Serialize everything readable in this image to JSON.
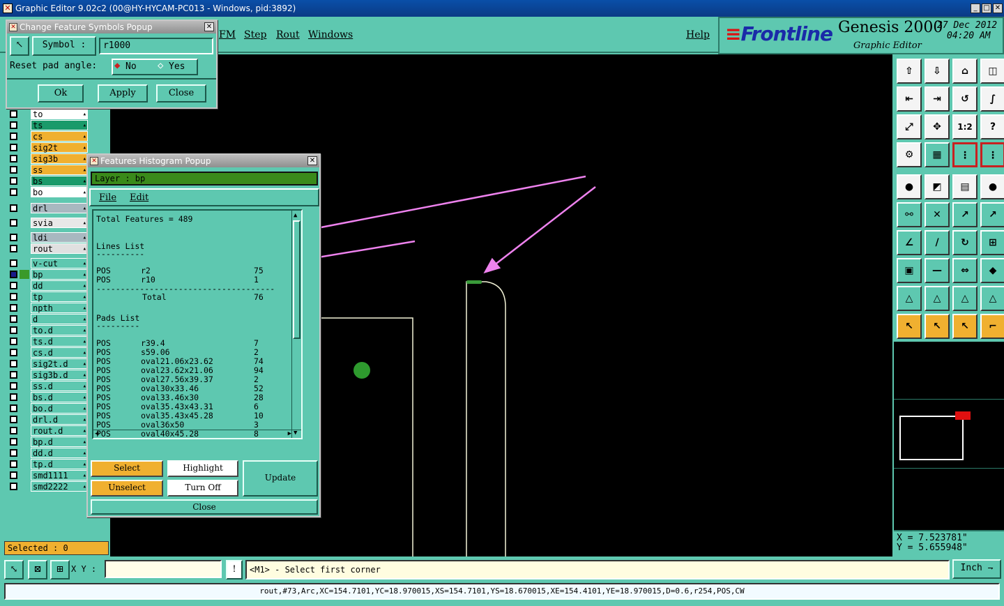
{
  "window": {
    "title": "Graphic Editor 9.02c2 (00@HY-HYCAM-PC013 - Windows, pid:3892)",
    "min": "_",
    "max": "□",
    "close": "✕"
  },
  "menus": {
    "fm": "FM",
    "step": "Step",
    "rout": "Rout",
    "windows": "Windows",
    "help": "Help"
  },
  "brand": {
    "frontline": "Frontline",
    "genesis": "Genesis 2000",
    "subtitle": "Graphic Editor",
    "date": "27 Dec 2012",
    "time": "04:20 AM"
  },
  "change_symbol_popup": {
    "title": "Change Feature Symbols Popup",
    "symbol_label": "Symbol :",
    "symbol_value": "r1000",
    "reset_label": "Reset pad angle:",
    "opt_no": "No",
    "opt_yes": "Yes",
    "ok": "Ok",
    "apply": "Apply",
    "close": "Close"
  },
  "layers": [
    {
      "name": "to",
      "color": "#ffffff"
    },
    {
      "name": "ts",
      "color": "#1a9a6a"
    },
    {
      "name": "cs",
      "color": "#f0b030"
    },
    {
      "name": "sig2t",
      "color": "#f0b030"
    },
    {
      "name": "sig3b",
      "color": "#f0b030"
    },
    {
      "name": "ss",
      "color": "#f0b030"
    },
    {
      "name": "bs",
      "color": "#1a9a6a"
    },
    {
      "name": "bo",
      "color": "#ffffff"
    },
    {
      "name": "drl",
      "color": "#a8b8c0"
    },
    {
      "name": "svia",
      "color": "#e8e8e8"
    },
    {
      "name": "ldi",
      "color": "#a8b8c0"
    },
    {
      "name": "rout",
      "color": "#e0e0e0"
    },
    {
      "name": "v-cut",
      "color": "#5ec8b0"
    },
    {
      "name": "bp",
      "color": "#5ec8b0"
    },
    {
      "name": "dd",
      "color": "#5ec8b0"
    },
    {
      "name": "tp",
      "color": "#5ec8b0"
    },
    {
      "name": "npth",
      "color": "#5ec8b0"
    },
    {
      "name": "d",
      "color": "#5ec8b0"
    },
    {
      "name": "to.d",
      "color": "#5ec8b0"
    },
    {
      "name": "ts.d",
      "color": "#5ec8b0"
    },
    {
      "name": "cs.d",
      "color": "#5ec8b0"
    },
    {
      "name": "sig2t.d",
      "color": "#5ec8b0"
    },
    {
      "name": "sig3b.d",
      "color": "#5ec8b0"
    },
    {
      "name": "ss.d",
      "color": "#5ec8b0"
    },
    {
      "name": "bs.d",
      "color": "#5ec8b0"
    },
    {
      "name": "bo.d",
      "color": "#5ec8b0"
    },
    {
      "name": "drl.d",
      "color": "#5ec8b0"
    },
    {
      "name": "rout.d",
      "color": "#5ec8b0"
    },
    {
      "name": "bp.d",
      "color": "#5ec8b0"
    },
    {
      "name": "dd.d",
      "color": "#5ec8b0"
    },
    {
      "name": "tp.d",
      "color": "#5ec8b0"
    },
    {
      "name": "smd1111",
      "color": "#5ec8b0"
    },
    {
      "name": "smd2222",
      "color": "#5ec8b0"
    }
  ],
  "selected": "Selected : 0",
  "histogram": {
    "title": "Features Histogram Popup",
    "layer": "Layer :  bp",
    "menu_file": "File",
    "menu_edit": "Edit",
    "total_features": "Total Features = 489",
    "lines_title": "Lines List",
    "lines": [
      {
        "pol": "POS",
        "sym": "r2",
        "count": "75"
      },
      {
        "pol": "POS",
        "sym": "r10",
        "count": "1"
      }
    ],
    "lines_total_label": "Total",
    "lines_total": "76",
    "pads_title": "Pads List",
    "pads": [
      {
        "pol": "POS",
        "sym": "r39.4",
        "count": "7"
      },
      {
        "pol": "POS",
        "sym": "s59.06",
        "count": "2"
      },
      {
        "pol": "POS",
        "sym": "oval21.06x23.62",
        "count": "74"
      },
      {
        "pol": "POS",
        "sym": "oval23.62x21.06",
        "count": "94"
      },
      {
        "pol": "POS",
        "sym": "oval27.56x39.37",
        "count": "2"
      },
      {
        "pol": "POS",
        "sym": "oval30x33.46",
        "count": "52"
      },
      {
        "pol": "POS",
        "sym": "oval33.46x30",
        "count": "28"
      },
      {
        "pol": "POS",
        "sym": "oval35.43x43.31",
        "count": "6"
      },
      {
        "pol": "POS",
        "sym": "oval35.43x45.28",
        "count": "10"
      },
      {
        "pol": "POS",
        "sym": "oval36x50",
        "count": "3"
      },
      {
        "pol": "POS",
        "sym": "oval40x45.28",
        "count": "8"
      }
    ],
    "select": "Select",
    "highlight": "Highlight",
    "update": "Update",
    "unselect": "Unselect",
    "turn_off": "Turn Off",
    "close": "Close"
  },
  "coords": {
    "x": "X = 7.523781\"",
    "y": "Y = 5.655948\""
  },
  "bottom": {
    "xy_label": "X Y :",
    "xy_value": "",
    "prompt": "<M1> - Select first corner",
    "units": "Inch"
  },
  "status": "rout,#73,Arc,XC=154.7101,YC=18.970015,XS=154.7101,YS=18.670015,XE=154.4101,YE=18.970015,D=0.6,r254,POS,CW",
  "colors": {
    "bg": "#5ec8b0",
    "annotation": "#ee82ee",
    "pad_green": "#2e9a2e",
    "highlight_orange": "#f0b030"
  },
  "icons": [
    "layer-up-icon",
    "layer-down-icon",
    "home-icon",
    "split-icon",
    "pan-left-icon",
    "pan-right-icon",
    "undo-icon",
    "snap-icon",
    "zoom-fit-icon",
    "zoom-center-icon",
    "zoom-1-2-icon",
    "help-icon",
    "measure-icon",
    "grid-icon",
    "tool-red1-icon",
    "tool-red2-icon",
    "pad-icon",
    "poly-icon",
    "ruler-icon",
    "circle-icon",
    "connect-icon",
    "cross-icon",
    "point-icon",
    "point2-icon",
    "angle-icon",
    "line-icon",
    "rotate-icon",
    "align-icon",
    "select-box-icon",
    "minus-icon",
    "fit-icon",
    "shapes-icon",
    "tri1-icon",
    "tri2-icon",
    "tri3-icon",
    "tri4-icon",
    "pointer-icon",
    "pointer2-icon",
    "pointer3-icon",
    "route-icon"
  ]
}
